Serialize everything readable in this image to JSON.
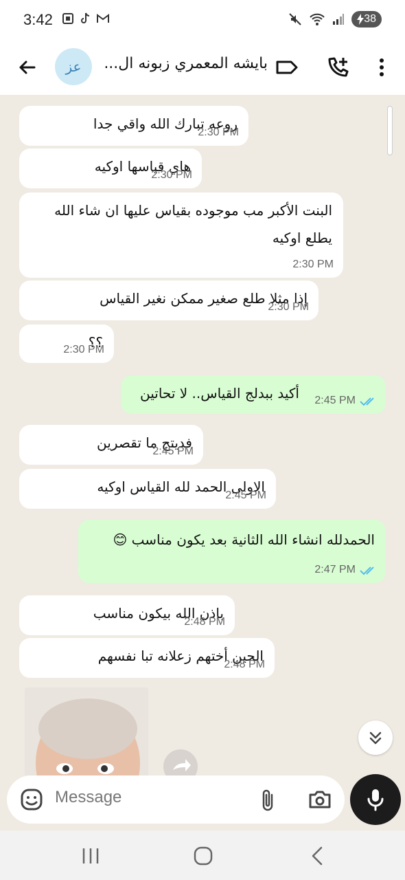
{
  "status_bar": {
    "time": "3:42",
    "battery": "38"
  },
  "header": {
    "contact_name": "بايشه المعمري زبونه ال...",
    "avatar_text": "عز"
  },
  "messages": [
    {
      "direction": "in",
      "text": "روعه تبارك الله واقي جدا",
      "time": "2:30 PM"
    },
    {
      "direction": "in",
      "text": "هاي قياسها اوكيه",
      "time": "2:30 PM"
    },
    {
      "direction": "in",
      "text_lines": [
        "البنت الأكبر مب موجوده بقياس عليها ان شاء الله",
        "يطلع اوكيه"
      ],
      "time": "2:30 PM"
    },
    {
      "direction": "in",
      "text": "إذا مثلا طلع صغير ممكن نغير القياس",
      "time": "2:30 PM"
    },
    {
      "direction": "in",
      "text": "؟؟",
      "time": "2:30 PM"
    },
    {
      "direction": "out",
      "text": "أكيد ببدلج القياس.. لا تحاتين",
      "time": "2:45 PM",
      "read": true
    },
    {
      "direction": "in",
      "text": "فديتج ما تقصرين",
      "time": "2:45 PM"
    },
    {
      "direction": "in",
      "text": "الاولى الحمد لله القياس اوكيه",
      "time": "2:45 PM"
    },
    {
      "direction": "out",
      "text": "الحمدلله انشاء الله الثانية بعد يكون مناسب 😊",
      "time": "2:47 PM",
      "read": true
    },
    {
      "direction": "in",
      "text": "باذن الله بيكون مناسب",
      "time": "2:48 PM"
    },
    {
      "direction": "in",
      "text": "الحين أختهم زعلانه تبا نفسهم",
      "time": "2:48 PM"
    }
  ],
  "input": {
    "placeholder": "Message"
  },
  "colors": {
    "incoming": "#ffffff",
    "outgoing": "#d9fdd3",
    "chat_bg": "#efeae2",
    "tick": "#53bdeb"
  },
  "icons": [
    "back-arrow-icon",
    "label-icon",
    "call-add-icon",
    "more-vert-icon",
    "emoji-icon",
    "attach-icon",
    "camera-icon",
    "mic-icon",
    "chevron-double-down-icon",
    "forward-icon"
  ]
}
